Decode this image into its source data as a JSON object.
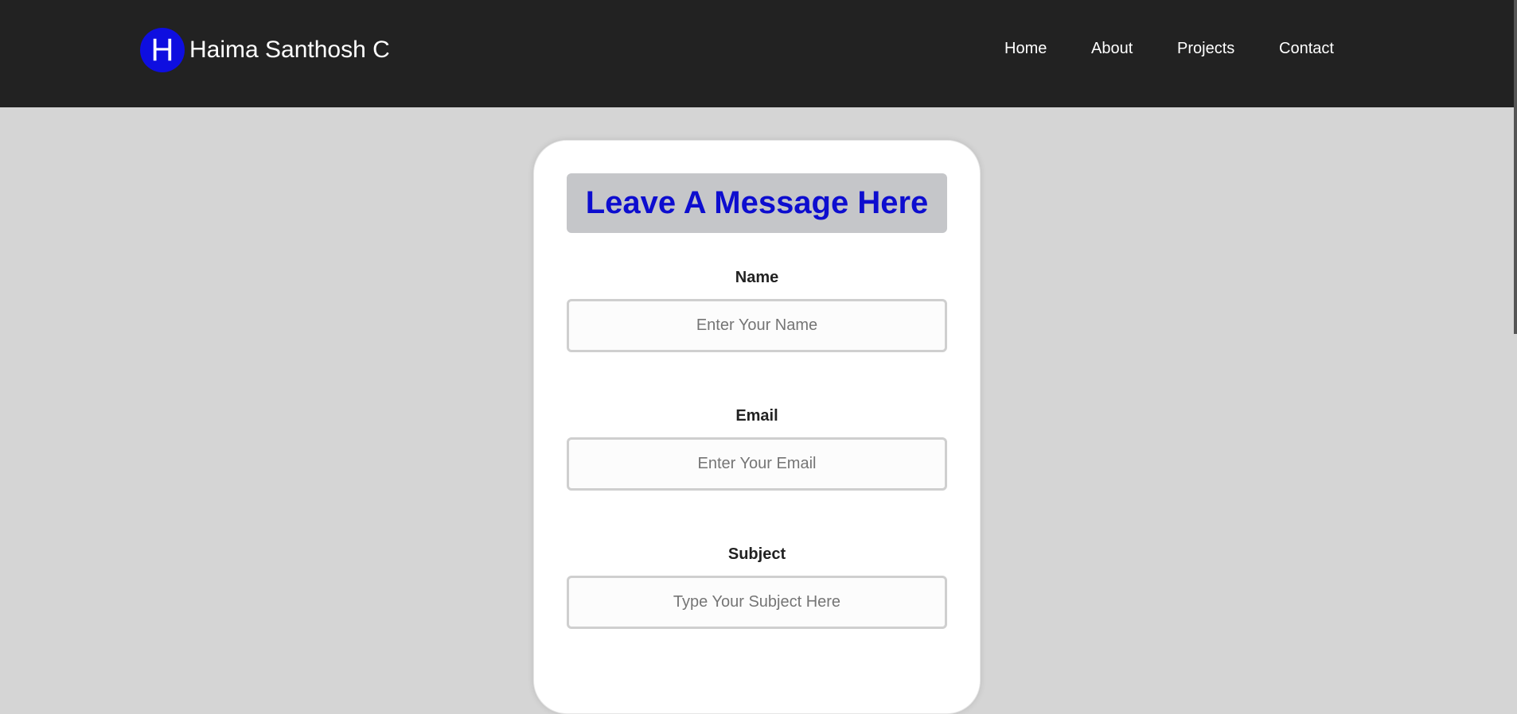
{
  "header": {
    "logo_letter": "H",
    "brand_name": "Haima Santhosh C",
    "nav": {
      "home": "Home",
      "about": "About",
      "projects": "Projects",
      "contact": "Contact"
    }
  },
  "form": {
    "title": "Leave A Message Here",
    "fields": {
      "name": {
        "label": "Name",
        "placeholder": "Enter Your Name"
      },
      "email": {
        "label": "Email",
        "placeholder": "Enter Your Email"
      },
      "subject": {
        "label": "Subject",
        "placeholder": "Type Your Subject Here"
      }
    }
  },
  "colors": {
    "navbar_bg": "#222222",
    "page_bg": "#d5d5d5",
    "logo_bg": "#0e0ee0",
    "title_text": "#0d0dcf",
    "title_bg": "#c5c6c9"
  }
}
